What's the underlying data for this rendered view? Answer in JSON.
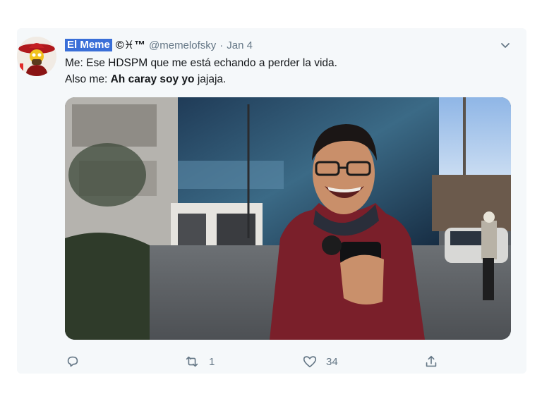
{
  "tweet": {
    "display_name": "El Meme",
    "name_symbols": "©♓™",
    "handle": "@memelofsky",
    "separator": "·",
    "date": "Jan 4",
    "line1": "Me: Ese HDSPM que me está echando a perder la vida.",
    "line2_prefix": "Also me: ",
    "line2_bold": "Ah caray soy yo",
    "line2_suffix": " jajaja."
  },
  "actions": {
    "reply_icon": "reply-icon",
    "retweet_icon": "retweet-icon",
    "retweet_count": "1",
    "like_icon": "heart-icon",
    "like_count": "34",
    "share_icon": "share-icon"
  },
  "colors": {
    "name_highlight": "#3a6fd8",
    "muted": "#657786",
    "card_bg": "#f5f8fa"
  }
}
